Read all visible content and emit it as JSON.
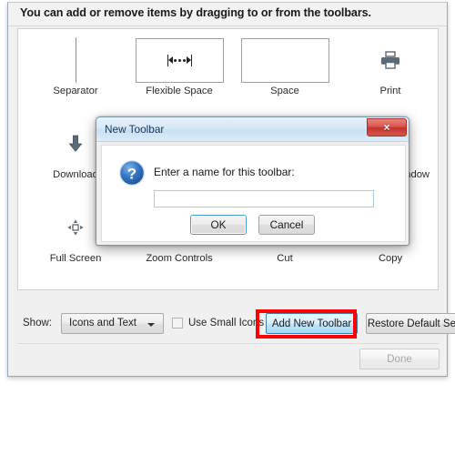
{
  "window": {
    "instruction": "You can add or remove items by dragging to or from the toolbars."
  },
  "palette": {
    "rows": [
      {
        "items": [
          {
            "label": "Separator",
            "icon": "separator-line-icon"
          },
          {
            "label": "Flexible Space",
            "icon": "flexible-space-icon"
          },
          {
            "label": "Space",
            "icon": "space-box-icon"
          },
          {
            "label": "Print",
            "icon": "printer-icon"
          }
        ]
      },
      {
        "items": [
          {
            "label": "Download",
            "icon": "download-arrow-icon"
          },
          {
            "label": "",
            "icon": "hidden-behind-dialog"
          },
          {
            "label": "",
            "icon": "hidden-behind-dialog"
          },
          {
            "label": "ndow",
            "icon": "new-window-icon"
          }
        ]
      },
      {
        "items": [
          {
            "label": "Full Screen",
            "icon": "full-screen-icon"
          },
          {
            "label": "Zoom Controls",
            "icon": "zoom-controls-icon"
          },
          {
            "label": "Cut",
            "icon": "scissors-icon"
          },
          {
            "label": "Copy",
            "icon": "copy-icon"
          }
        ]
      }
    ]
  },
  "controls": {
    "show_label": "Show:",
    "show_value": "Icons and Text",
    "show_options": [
      "Icons and Text"
    ],
    "small_icons_label": "Use Small Icons",
    "small_icons_checked": false,
    "add_new_toolbar_label": "Add New Toolbar",
    "restore_default_label": "Restore Default Set",
    "done_label": "Done",
    "highlight_color": "#ff0000"
  },
  "dialog": {
    "title": "New Toolbar",
    "close_label": "×",
    "prompt": "Enter a name for this toolbar:",
    "input_value": "",
    "input_placeholder": "",
    "ok_label": "OK",
    "cancel_label": "Cancel",
    "icon": "question-mark-icon"
  }
}
